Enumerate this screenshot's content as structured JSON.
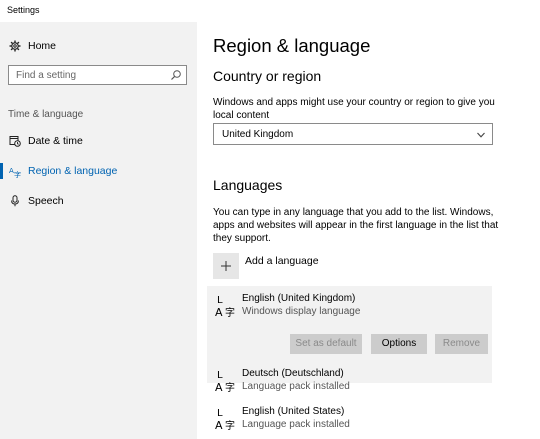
{
  "window": {
    "title": "Settings"
  },
  "sidebar": {
    "home_label": "Home",
    "search_placeholder": "Find a setting",
    "section_label": "Time & language",
    "items": [
      {
        "label": "Date & time",
        "icon": "calendar-clock-icon"
      },
      {
        "label": "Region & language",
        "icon": "region-language-icon",
        "active": true
      },
      {
        "label": "Speech",
        "icon": "microphone-icon"
      }
    ],
    "accent_color": "#0063b1"
  },
  "main": {
    "page_title": "Region & language",
    "country": {
      "heading": "Country or region",
      "description": "Windows and apps might use your country or region to give you local content",
      "selected": "United Kingdom"
    },
    "languages": {
      "heading": "Languages",
      "description": "You can type in any language that you add to the list. Windows, apps and websites will appear in the first language in the list that they support.",
      "add_label": "Add a language",
      "list": [
        {
          "name": "English (United Kingdom)",
          "status": "Windows display language"
        },
        {
          "name": "Deutsch (Deutschland)",
          "status": "Language pack installed"
        },
        {
          "name": "English (United States)",
          "status": "Language pack installed"
        }
      ],
      "buttons": {
        "set_default": "Set as default",
        "options": "Options",
        "remove": "Remove"
      }
    }
  }
}
